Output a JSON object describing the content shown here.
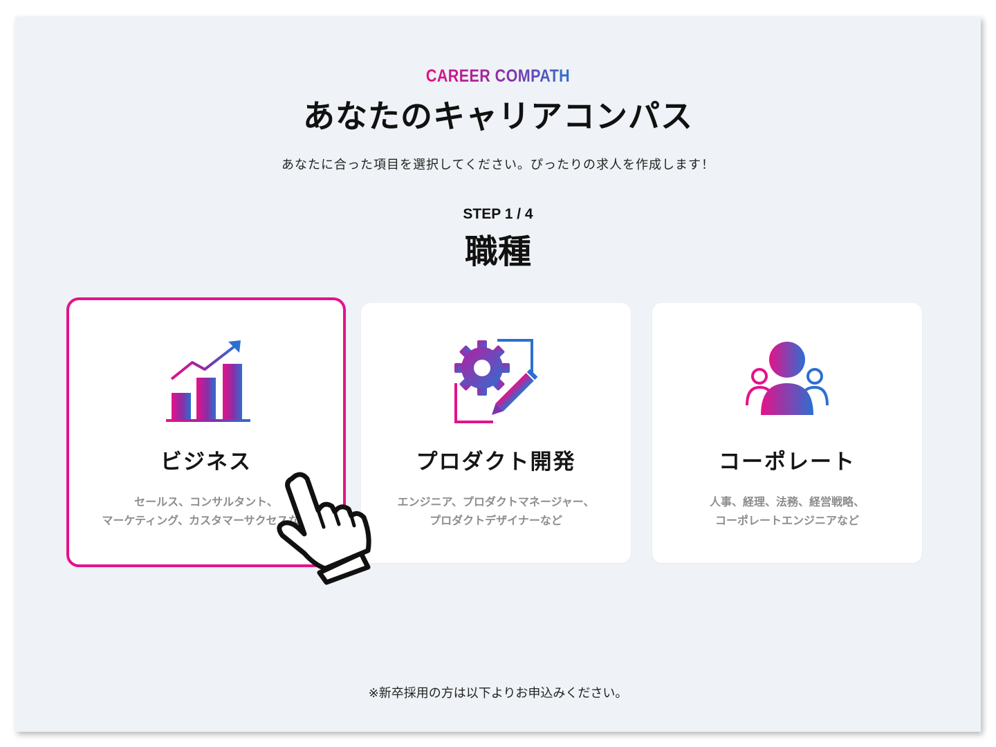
{
  "brand": "CAREER COMPATH",
  "title": "あなたのキャリアコンパス",
  "subtitle": "あなたに合った項目を選択してください。ぴったりの求人を作成します！",
  "step": {
    "label": "STEP 1 / 4",
    "title": "職種"
  },
  "cards": [
    {
      "label": "ビジネス",
      "desc": "セールス、コンサルタント、\nマーケティング、カスタマーサクセスなど",
      "icon": "growth-chart-icon",
      "selected": true
    },
    {
      "label": "プロダクト開発",
      "desc": "エンジニア、プロダクトマネージャー、\nプロダクトデザイナーなど",
      "icon": "gear-pen-icon",
      "selected": false
    },
    {
      "label": "コーポレート",
      "desc": "人事、経理、法務、経営戦略、\nコーポレートエンジニアなど",
      "icon": "team-people-icon",
      "selected": false
    }
  ],
  "footnote": "※新卒採用の方は以下よりお申込みください。",
  "colors": {
    "accent_pink": "#e4128a",
    "accent_blue": "#2d6fd1",
    "background": "#eff2f6"
  }
}
